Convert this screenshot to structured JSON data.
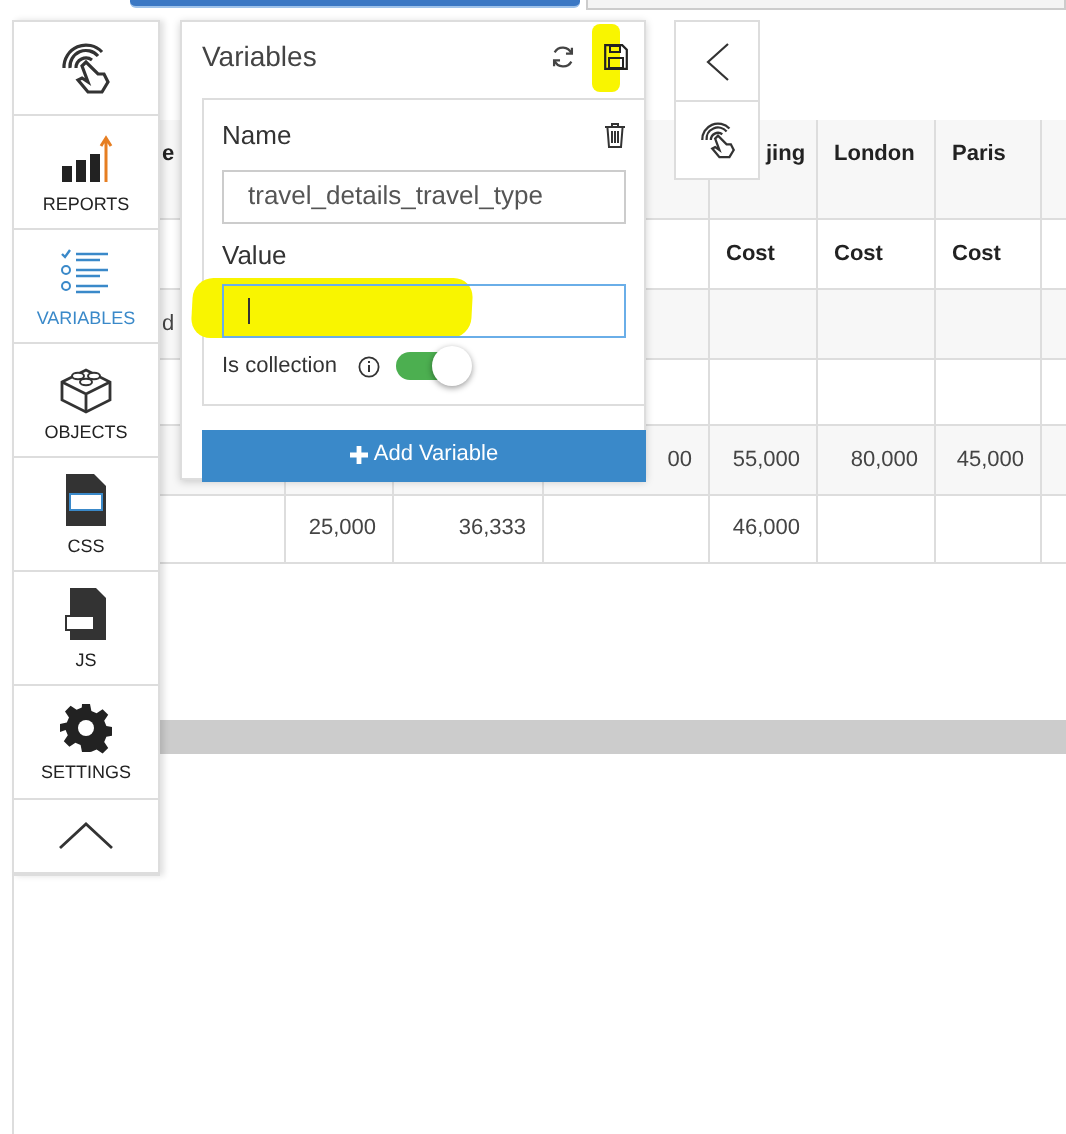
{
  "sidebar": {
    "items": [
      {
        "kind": "touch"
      },
      {
        "kind": "reports",
        "label": "REPORTS",
        "selected": false
      },
      {
        "kind": "variables",
        "label": "VARIABLES",
        "selected": true
      },
      {
        "kind": "objects",
        "label": "OBJECTS",
        "selected": false
      },
      {
        "kind": "css",
        "label": "CSS",
        "selected": false
      },
      {
        "kind": "js",
        "label": "JS",
        "selected": false
      },
      {
        "kind": "settings",
        "label": "SETTINGS",
        "selected": false
      },
      {
        "kind": "collapse"
      }
    ]
  },
  "table": {
    "rows": [
      {
        "column_1": "e",
        "column_5": "jing",
        "column_6": "London",
        "column_7": "Paris"
      },
      {
        "column_5": "Cost",
        "column_6": "Cost",
        "column_7": "Cost"
      },
      {
        "column_1": "d"
      },
      {},
      {
        "column_4": "00",
        "column_5": "55,000",
        "column_6": "80,000",
        "column_7": "45,000"
      },
      {
        "column_2": "25,000",
        "column_3": "36,333",
        "column_5": "46,000"
      }
    ]
  },
  "variables_panel": {
    "title": "Variables",
    "name_label": "Name",
    "name_value": "travel_details_travel_type",
    "value_label": "Value",
    "collection_label": "Is collection",
    "is_collection": true,
    "add_button": "Add Variable"
  },
  "side_panel": {
    "buttons": [
      {
        "kind": "collapse-left"
      },
      {
        "kind": "touch"
      }
    ]
  }
}
